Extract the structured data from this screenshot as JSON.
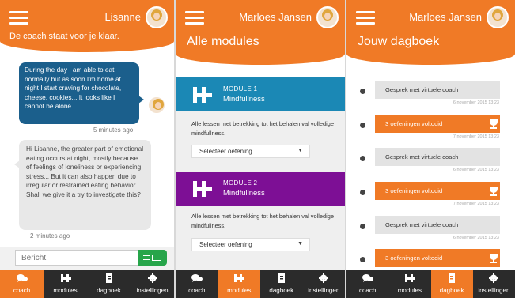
{
  "colors": {
    "accent": "#f07a26",
    "module1": "#1b88b5",
    "module2": "#7d0f95",
    "chat_user_bubble": "#1b5f8c",
    "tabbar": "#2b2b2b",
    "send": "#27a54a"
  },
  "tabs": [
    "coach",
    "modules",
    "dagboek",
    "instellingen"
  ],
  "screen1": {
    "user": "Lisanne",
    "subtitle": "De coach staat voor je klaar.",
    "messages": [
      {
        "from": "user",
        "text": "During the day I am able to eat normally but as soon I'm home at night I start craving for chocolate, cheese, cookies... It looks like I cannot be alone...",
        "time": "5 minutes ago"
      },
      {
        "from": "coach",
        "text": "Hi Lisanne, the greater part of emotional eating occurs at night, mostly because of feelings of loneliness or experiencing stress... But it can also happen due to irregular or restrained eating behavior. Shall we give it a try to investigate this?",
        "time": "2 minutes ago"
      }
    ],
    "input_placeholder": "Bericht",
    "active_tab": "coach"
  },
  "screen2": {
    "user": "Marloes Jansen",
    "title": "Alle modules",
    "modules": [
      {
        "number": "MODULE 1",
        "name": "Mindfullness",
        "description": "Alle lessen met betrekking tot het behalen val volledige mindfullness.",
        "select": "Selecteer oefening",
        "color": "#1b88b5"
      },
      {
        "number": "MODULE 2",
        "name": "Mindfullness",
        "description": "Alle lessen met betrekking tot het behalen val volledige mindfullness.",
        "select": "Selecteer oefening",
        "color": "#7d0f95"
      }
    ],
    "active_tab": "modules"
  },
  "screen3": {
    "user": "Marloes Jansen",
    "title": "Jouw dagboek",
    "entries": [
      {
        "text": "Gesprek met virtuele coach",
        "date": "6 november 2015 13:23",
        "kind": "grey"
      },
      {
        "text": "3 oefeningen voltooid",
        "date": "7 november 2015 13:23",
        "kind": "orange"
      },
      {
        "text": "Gesprek met virtuele coach",
        "date": "6 november 2015 13:23",
        "kind": "grey"
      },
      {
        "text": "3 oefeningen voltooid",
        "date": "7 november 2015 13:23",
        "kind": "orange"
      },
      {
        "text": "Gesprek met virtuele coach",
        "date": "6 november 2015 13:23",
        "kind": "grey"
      },
      {
        "text": "3 oefeningen voltooid",
        "date": "",
        "kind": "orange"
      }
    ],
    "active_tab": "dagboek"
  },
  "icons": {
    "menu": "hamburger-icon",
    "send": "envelope-icon",
    "coach": "chat-bubbles-icon",
    "modules": "plus-logo-icon",
    "dagboek": "diary-icon",
    "instellingen": "gear-icon",
    "achievement": "trophy-icon"
  }
}
